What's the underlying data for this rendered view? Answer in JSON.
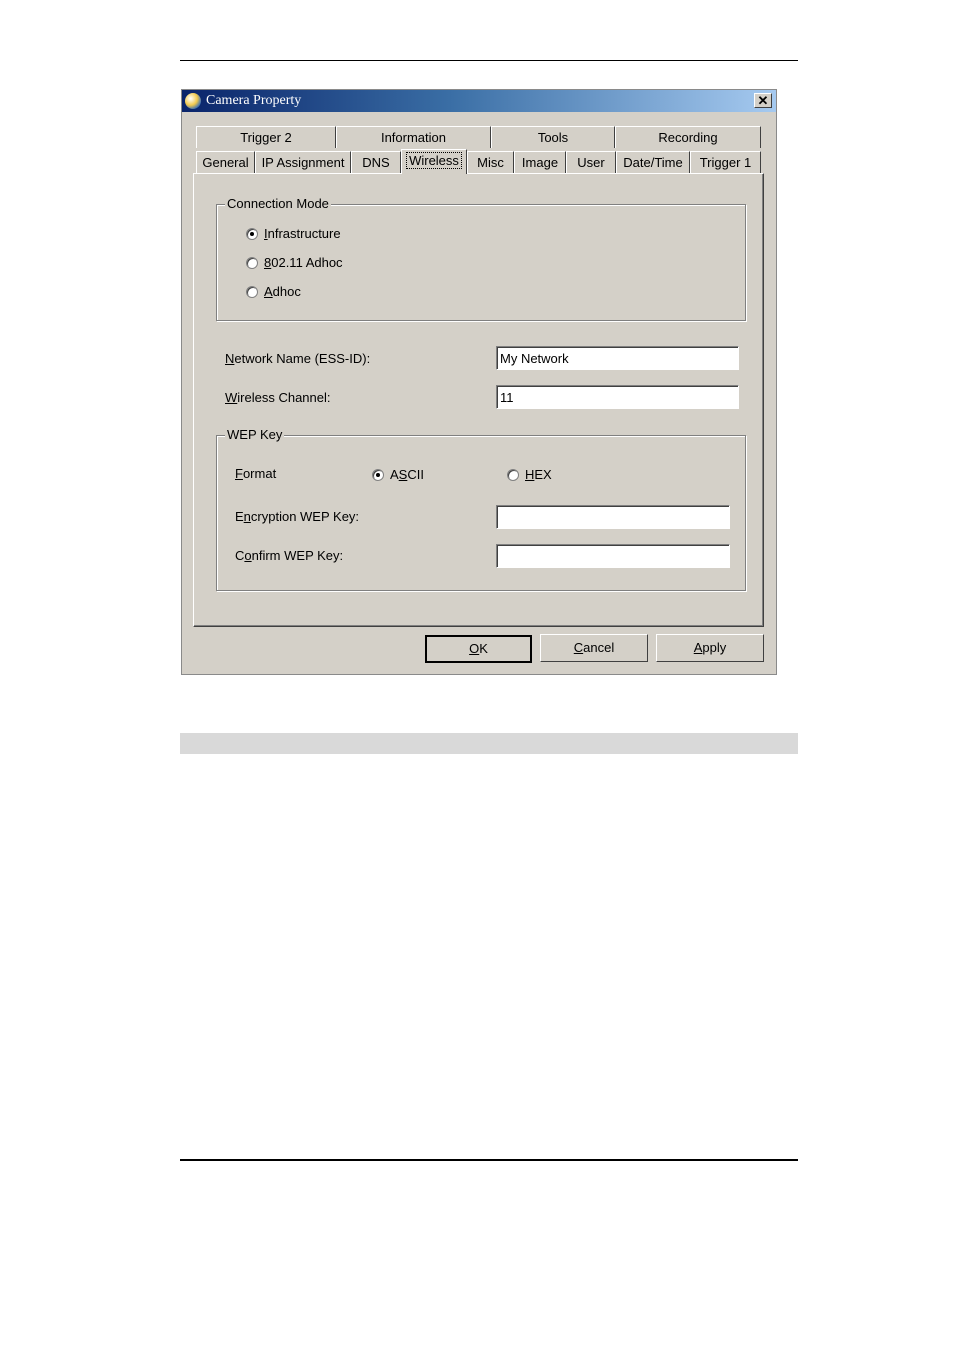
{
  "window": {
    "title": "Camera Property",
    "close_label": "✕"
  },
  "tabs_row_back": [
    {
      "label": "Trigger 2"
    },
    {
      "label": "Information"
    },
    {
      "label": "Tools"
    },
    {
      "label": "Recording"
    }
  ],
  "tabs_row_front": [
    {
      "label": "General"
    },
    {
      "label": "IP Assignment"
    },
    {
      "label": "DNS"
    },
    {
      "label": "Wireless",
      "active": true
    },
    {
      "label": "Misc"
    },
    {
      "label": "Image"
    },
    {
      "label": "User"
    },
    {
      "label": "Date/Time"
    },
    {
      "label": "Trigger 1"
    }
  ],
  "connection_mode": {
    "legend": "Connection Mode",
    "options": [
      {
        "label_mn": "I",
        "label_rest": "nfrastructure",
        "checked": true
      },
      {
        "label_mn": "8",
        "label_rest": "02.11 Adhoc",
        "checked": false
      },
      {
        "label_mn": "A",
        "label_rest": "dhoc",
        "checked": false
      }
    ]
  },
  "network_name": {
    "label_mn": "N",
    "label_rest": "etwork Name (ESS-ID):",
    "value": "My Network"
  },
  "wireless_channel": {
    "label_mn": "W",
    "label_rest": "ireless Channel:",
    "value": "11"
  },
  "wep_key": {
    "legend": "WEP Key",
    "format": {
      "label_mn": "F",
      "label_rest": "ormat",
      "ascii": {
        "pre": "A",
        "mn": "S",
        "rest": "CII",
        "checked": true
      },
      "hex": {
        "mn": "H",
        "rest": "EX",
        "checked": false
      }
    },
    "encryption": {
      "pre": "E",
      "mn": "n",
      "rest": "cryption WEP Key:",
      "value": ""
    },
    "confirm": {
      "pre": "C",
      "mn": "o",
      "rest": "nfirm WEP Key:",
      "value": ""
    }
  },
  "buttons": {
    "ok": {
      "mn": "O",
      "rest": "K"
    },
    "cancel": {
      "mn": "C",
      "rest": "ancel"
    },
    "apply": {
      "mn": "A",
      "rest": "pply"
    }
  }
}
